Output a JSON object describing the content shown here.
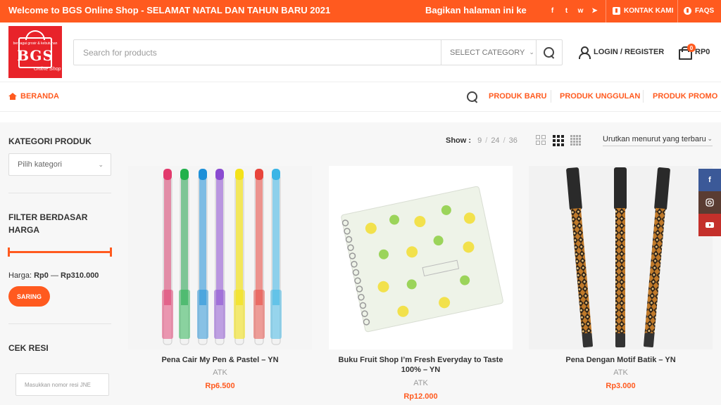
{
  "topbar": {
    "welcome": "Welcome to BGS Online Shop - SELAMAT NATAL DAN TAHUN BARU 2021",
    "share": "Bagikan halaman ini ke",
    "contact": "KONTAK KAMI",
    "faq": "FAQS",
    "socials": [
      "facebook-icon",
      "twitter-icon",
      "whatsapp-icon",
      "telegram-icon"
    ]
  },
  "logo": {
    "text": "BGS",
    "tagline": "berbagai grosir & kebutuhan",
    "subtext": "Online Shop"
  },
  "search": {
    "placeholder": "Search for products",
    "category": "SELECT CATEGORY"
  },
  "header": {
    "login": "LOGIN / REGISTER",
    "cart_count": "0",
    "cart_total": "RP0"
  },
  "nav": {
    "home": "BERANDA",
    "links": [
      "PRODUK BARU",
      "PRODUK UNGGULAN",
      "PRODUK PROMO"
    ]
  },
  "sidebar": {
    "category_title": "KATEGORI PRODUK",
    "category_select": "Pilih kategori",
    "price_filter_title": "FILTER BERDASAR HARGA",
    "price_label": "Harga:",
    "price_min": "Rp0",
    "price_dash": "—",
    "price_max": "Rp310.000",
    "filter_button": "SARING",
    "resi_title": "CEK RESI",
    "resi_placeholder": "Masukkan nomor resi JNE"
  },
  "toolbar": {
    "show_label": "Show :",
    "show_options": [
      "9",
      "24",
      "36"
    ],
    "sort": "Urutkan menurut yang terbaru"
  },
  "products": [
    {
      "name": "Pena Cair My Pen & Pastel – YN",
      "category": "ATK",
      "price": "Rp6.500"
    },
    {
      "name": "Buku Fruit Shop I’m Fresh Everyday to Taste 100% – YN",
      "category": "ATK",
      "price": "Rp12.000"
    },
    {
      "name": "Pena Dengan Motif Batik – YN",
      "category": "ATK",
      "price": "Rp3.000"
    }
  ],
  "floating_social": [
    "facebook-icon",
    "instagram-icon",
    "youtube-icon"
  ],
  "colors": {
    "accent": "#ff5a1f",
    "logo_red": "#e8232a",
    "facebook": "#3b5998",
    "instagram": "#5a3c32",
    "youtube": "#c4302b"
  }
}
